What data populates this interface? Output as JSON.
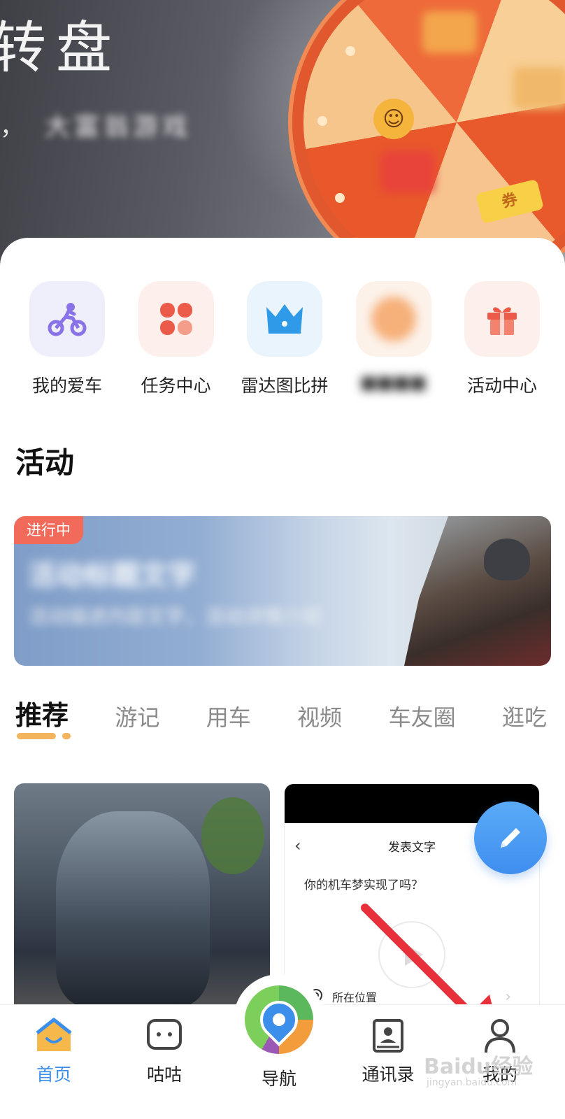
{
  "banner": {
    "title": "转盘",
    "subtitle_prefix": "，",
    "subtitle_blurred": "大富翁游戏",
    "ticket_text": "券"
  },
  "shortcuts": [
    {
      "label": "我的爱车",
      "icon": "motorbike-rider-icon",
      "bg": "#efeefb"
    },
    {
      "label": "任务中心",
      "icon": "four-petal-grid-icon",
      "bg": "#fdf0ec"
    },
    {
      "label": "雷达图比拼",
      "icon": "crown-icon",
      "bg": "#eaf4fd"
    },
    {
      "label": "■■■■",
      "icon": "blurred-icon",
      "bg": "#fdf2ea"
    },
    {
      "label": "活动中心",
      "icon": "gift-icon",
      "bg": "#fdf0ec"
    }
  ],
  "activity": {
    "section_title": "活动",
    "badge": "进行中",
    "title_blurred": "活动标题文字",
    "desc_blurred": "活动描述内容文字，活动详情介绍"
  },
  "tabs": [
    "推荐",
    "游记",
    "用车",
    "视频",
    "车友圈",
    "逛吃"
  ],
  "active_tab": 0,
  "feed": {
    "right_card": {
      "header_title": "发表文字",
      "prompt": "你的机车梦实现了吗？",
      "location_label": "所在位置"
    }
  },
  "bottom_nav": [
    {
      "label": "首页",
      "icon": "home-icon",
      "active": true
    },
    {
      "label": "咕咕",
      "icon": "chat-bubble-icon",
      "active": false
    },
    {
      "label": "导航",
      "icon": "navigation-pin-icon",
      "active": false
    },
    {
      "label": "通讯录",
      "icon": "contacts-icon",
      "active": false
    },
    {
      "label": "我的",
      "icon": "profile-icon",
      "active": false
    }
  ],
  "watermark": {
    "text": "Baidu经验",
    "sub": "jingyan.baidu.com"
  },
  "colors": {
    "accent": "#3b8eea",
    "badge": "#f26a5a",
    "tab_indicator": "#f2b45c",
    "arrow": "#e8303a"
  }
}
